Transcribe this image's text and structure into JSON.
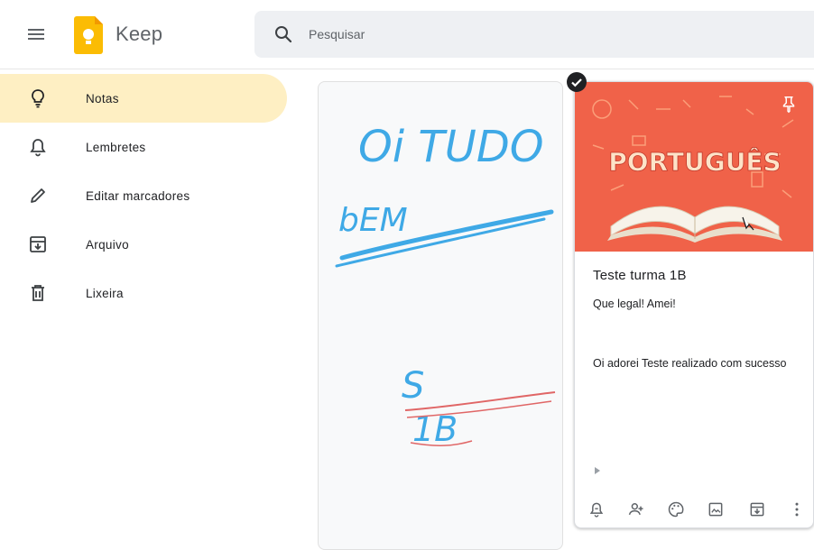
{
  "app": {
    "name": "Keep"
  },
  "search": {
    "placeholder": "Pesquisar"
  },
  "sidebar": {
    "items": [
      {
        "label": "Notas",
        "icon": "lightbulb-icon",
        "active": true
      },
      {
        "label": "Lembretes",
        "icon": "bell-icon"
      },
      {
        "label": "Editar marcadores",
        "icon": "pencil-icon"
      },
      {
        "label": "Arquivo",
        "icon": "archive-icon"
      },
      {
        "label": "Lixeira",
        "icon": "trash-icon"
      }
    ]
  },
  "notes": [
    {
      "kind": "drawing",
      "handwriting": [
        "Oi TUDO",
        "bEM",
        "S",
        "1B"
      ]
    },
    {
      "kind": "image-note",
      "image_text": "PORTUGUÊS",
      "title": "Teste turma 1B",
      "lines": [
        "Que legal! Amei!",
        "Oi adorei Teste realizado com sucesso"
      ],
      "selected": true
    }
  ],
  "colors": {
    "active_nav": "#feefc3",
    "image_bg": "#f06249",
    "ink_blue": "#3fa9e6",
    "ink_red": "#e06666"
  }
}
